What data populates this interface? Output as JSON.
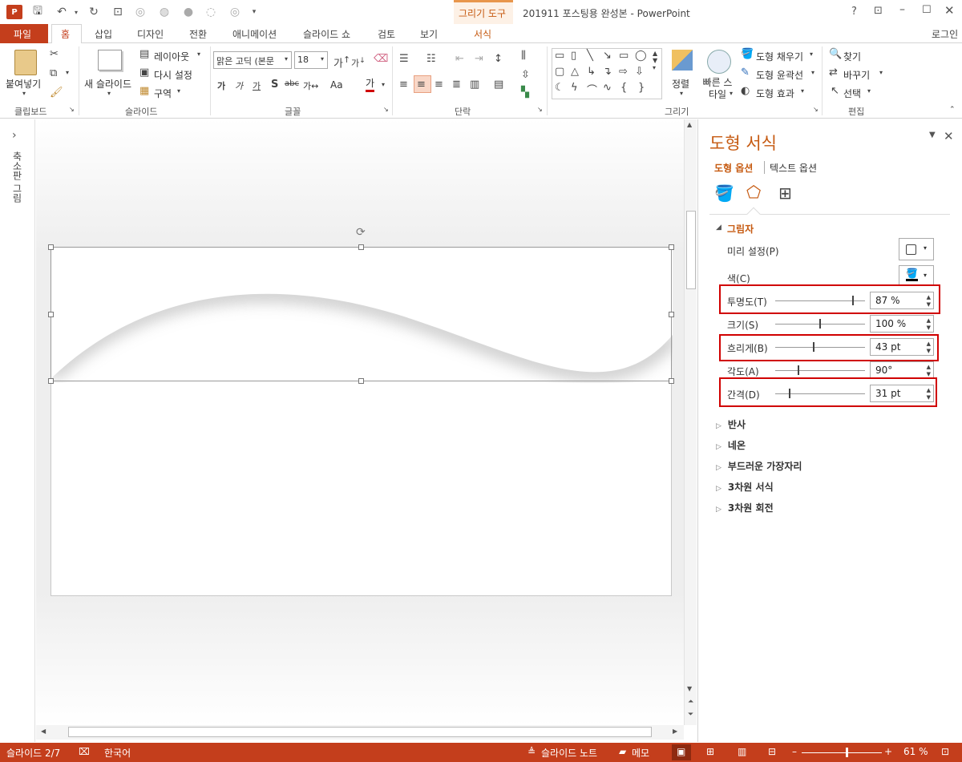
{
  "window": {
    "title": "201911 포스팅용 완성본 - PowerPoint",
    "context_tab_group": "그리기 도구",
    "help": "?",
    "login": "로그인"
  },
  "tabs": [
    {
      "label": "파일"
    },
    {
      "label": "홈"
    },
    {
      "label": "삽입"
    },
    {
      "label": "디자인"
    },
    {
      "label": "전환"
    },
    {
      "label": "애니메이션"
    },
    {
      "label": "슬라이드 쇼"
    },
    {
      "label": "검토"
    },
    {
      "label": "보기"
    },
    {
      "label": "서식"
    }
  ],
  "ribbon": {
    "clipboard": {
      "paste": "붙여넣기",
      "group": "클립보드"
    },
    "slides": {
      "new_slide": "새 슬라이드",
      "layout": "레이아웃",
      "reset": "다시 설정",
      "section": "구역",
      "group": "슬라이드"
    },
    "font": {
      "name": "맑은 고딕 (본문",
      "size": "18",
      "spacing": "가↔",
      "case": "Aa",
      "color_glyph": "가",
      "group": "글꼴"
    },
    "paragraph": {
      "group": "단락"
    },
    "drawing": {
      "arrange": "정렬",
      "quick_styles": "빠른 스타일",
      "fill": "도형 채우기",
      "outline": "도형 윤곽선",
      "effects": "도형 효과",
      "group": "그리기"
    },
    "editing": {
      "find": "찾기",
      "replace": "바꾸기",
      "select": "선택",
      "group": "편집"
    }
  },
  "left_pane": {
    "label": "축소판 그림",
    "expand": "›"
  },
  "panel": {
    "title": "도형 서식",
    "tabs": [
      "도형 옵션",
      "텍스트 옵션"
    ],
    "section_open": "그림자",
    "preset_label": "미리 설정(P)",
    "color_label": "색(C)",
    "rows": [
      {
        "label": "투명도(T)",
        "value": "87 %",
        "level": 0.87
      },
      {
        "label": "크기(S)",
        "value": "100 %",
        "level": 0.5
      },
      {
        "label": "흐리게(B)",
        "value": "43 pt",
        "level": 0.43
      },
      {
        "label": "각도(A)",
        "value": "90°",
        "level": 0.25
      },
      {
        "label": "간격(D)",
        "value": "31 pt",
        "level": 0.15
      }
    ],
    "collapsed_sections": [
      "반사",
      "네온",
      "부드러운 가장자리",
      "3차원 서식",
      "3차원 회전"
    ]
  },
  "status": {
    "slide": "슬라이드 2/7",
    "language": "한국어",
    "notes": "슬라이드 노트",
    "comments": "메모",
    "zoom": "61 %",
    "zoom_level": 0.61
  }
}
